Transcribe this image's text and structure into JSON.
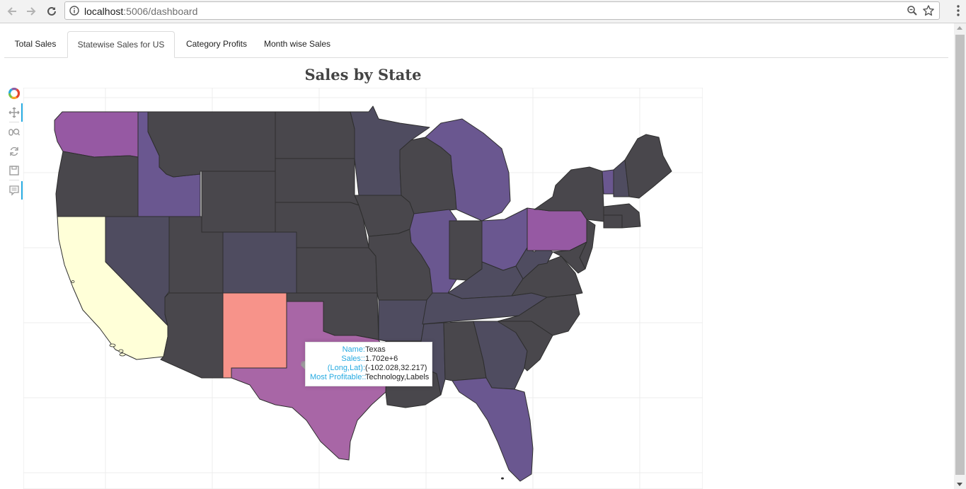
{
  "browser": {
    "url_host": "localhost",
    "url_rest": ":5006/dashboard"
  },
  "tabs": [
    {
      "label": "Total Sales",
      "active": false
    },
    {
      "label": "Statewise Sales for US",
      "active": true
    },
    {
      "label": "Category Profits",
      "active": false
    },
    {
      "label": "Month wise Sales",
      "active": false
    }
  ],
  "plot": {
    "title": "Sales by State",
    "tools": [
      "bokeh-logo-icon",
      "pan-icon",
      "wheel-zoom-icon",
      "reset-icon",
      "save-icon",
      "hover-icon"
    ]
  },
  "tooltip": {
    "rows": [
      {
        "key": "Name:",
        "value": "Texas"
      },
      {
        "key": "Sales::",
        "value": "1.702e+6"
      },
      {
        "key": "(Long,Lat):",
        "value": "(-102.028,32.217)"
      },
      {
        "key": "Most Profitable::",
        "value": "Technology,Labels"
      }
    ]
  },
  "colors": {
    "dark": "#49474c",
    "slate": "#4f4c60",
    "purple_mid": "#6a5790",
    "purple_light": "#9659a3",
    "purple_tx": "#a866a6",
    "salmon": "#f7938a",
    "cream": "#ffffd8",
    "accent": "#26aae1"
  }
}
